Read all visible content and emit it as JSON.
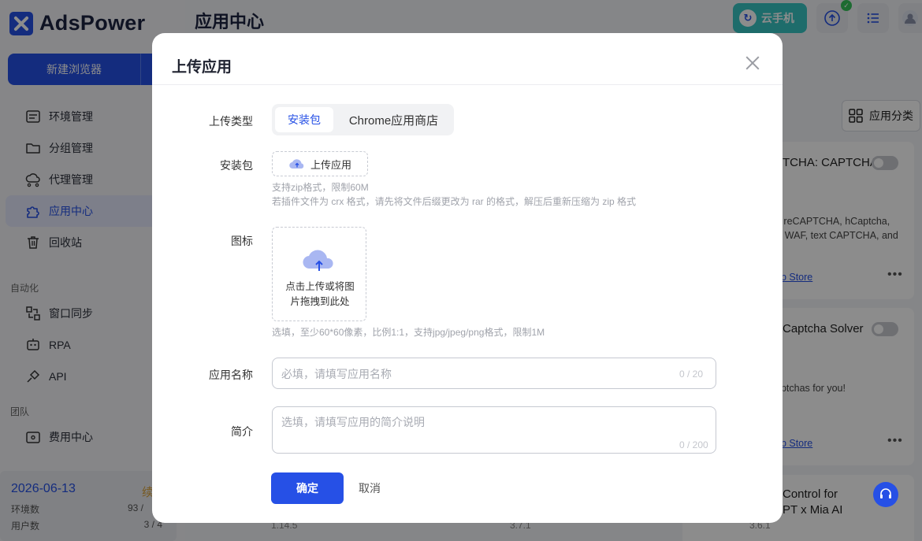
{
  "app": {
    "logo_text": "AdsPower",
    "page_title": "应用中心",
    "cloud_phone_label": "云手机",
    "new_browser_label": "新建浏览器"
  },
  "sidebar": {
    "items": [
      {
        "label": "环境管理",
        "icon": "profile-icon"
      },
      {
        "label": "分组管理",
        "icon": "folder-icon"
      },
      {
        "label": "代理管理",
        "icon": "proxy-icon"
      },
      {
        "label": "应用中心",
        "icon": "puzzle-icon",
        "active": true
      },
      {
        "label": "回收站",
        "icon": "trash-icon"
      }
    ],
    "automation_label": "自动化",
    "automation_items": [
      {
        "label": "窗口同步",
        "icon": "sync-icon"
      },
      {
        "label": "RPA",
        "icon": "robot-icon"
      },
      {
        "label": "API",
        "icon": "plug-icon"
      }
    ],
    "team_label": "团队",
    "team_items": [
      {
        "label": "费用中心",
        "icon": "wallet-icon"
      }
    ]
  },
  "stats": {
    "date": "2026-06-13",
    "renew": "续",
    "env_label": "环境数",
    "env_value": "93 /",
    "users_label": "用户数",
    "users_value": "3 / 4"
  },
  "right_panel": {
    "category_label": "应用分类",
    "cards": [
      {
        "title": "TCHA: CAPTCHA",
        "desc1": "e reCAPTCHA, hCaptcha,",
        "desc2": "S WAF, text CAPTCHA, and",
        "link": "eb Store"
      },
      {
        "title": "Captcha Solver",
        "desc1": "aptchas for you!",
        "link": "eb Store"
      },
      {
        "title1": "Control for",
        "title2": "PT x Mia AI",
        "version": "3.6.1"
      }
    ],
    "versions": [
      "1.14.5",
      "3.7.1"
    ]
  },
  "modal": {
    "title": "上传应用",
    "upload_type_label": "上传类型",
    "tabs": [
      "安装包",
      "Chrome应用商店"
    ],
    "package_label": "安装包",
    "upload_button": "上传应用",
    "package_hint1": "支持zip格式，限制60M",
    "package_hint2": "若插件文件为 crx 格式，请先将文件后缀更改为 rar 的格式，解压后重新压缩为 zip 格式",
    "icon_label": "图标",
    "icon_drop_line1": "点击上传或将图",
    "icon_drop_line2": "片拖拽到此处",
    "icon_hint": "选填，至少60*60像素，比例1:1，支持jpg/jpeg/png格式，限制1M",
    "name_label": "应用名称",
    "name_placeholder": "必填，请填写应用名称",
    "name_counter": "0 / 20",
    "desc_label": "简介",
    "desc_placeholder": "选填，请填写应用的简介说明",
    "desc_counter": "0 / 200",
    "confirm": "确定",
    "cancel": "取消"
  },
  "colors": {
    "primary": "#2650e6",
    "cloud_phone": "#38c5c3",
    "success": "#35c35a"
  }
}
